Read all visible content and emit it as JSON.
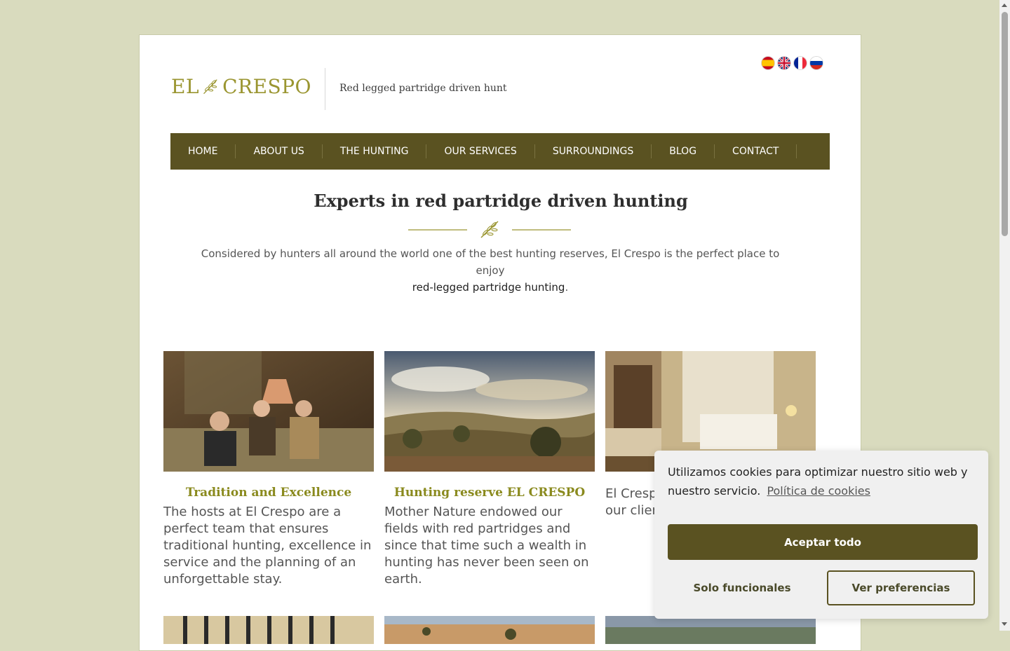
{
  "logo": {
    "text_left": "EL",
    "text_right": "CRESPO"
  },
  "tagline": "Red legged partridge driven hunt",
  "languages": [
    {
      "code": "es",
      "icon": "spain-flag-icon"
    },
    {
      "code": "en",
      "icon": "uk-flag-icon"
    },
    {
      "code": "fr",
      "icon": "france-flag-icon"
    },
    {
      "code": "ru",
      "icon": "russia-flag-icon"
    }
  ],
  "nav": {
    "items": [
      "HOME",
      "ABOUT US",
      "THE HUNTING",
      "OUR SERVICES",
      "SURROUNDINGS",
      "BLOG",
      "CONTACT"
    ]
  },
  "hero": {
    "title": "Experts in red partridge driven hunting",
    "intro_part1": "Considered by hunters all around the world one of the best hunting reserves, El Crespo is the perfect place to enjoy",
    "intro_link": "red-legged partridge hunting",
    "intro_end": "."
  },
  "cards": [
    {
      "title": "Tradition and Excellence",
      "text": "The hosts at El Crespo are a perfect team that ensures traditional hunting, excellence in service and the planning of an unforgettable stay."
    },
    {
      "title": "Hunting reserve EL CRESPO",
      "text": "Mother Nature endowed our fields with red partridges and since that time such a wealth in hunting has never been seen on earth."
    },
    {
      "title": "",
      "text": "El Crespo understands extension our clients high level"
    }
  ],
  "cookie_banner": {
    "message": "Utilizamos cookies para optimizar nuestro sitio web y nuestro servicio.",
    "policy_link": "Política de cookies",
    "accept_all": "Aceptar todo",
    "functional_only": "Solo funcionales",
    "preferences": "Ver preferencias"
  },
  "colors": {
    "background": "#d9dbbe",
    "nav": "#5a5221",
    "accent_olive": "#8a8a1e",
    "logo": "#9a9530"
  }
}
